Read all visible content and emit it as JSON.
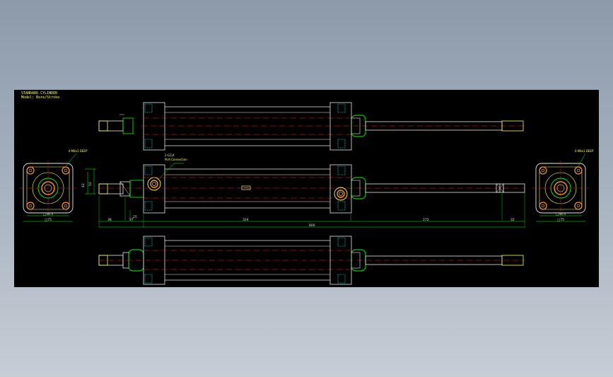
{
  "title_block": {
    "line1": "STANDARD CYLINDER",
    "line2": "Model: Bore/Stroke"
  },
  "notes": {
    "port_label": "2-G1/4",
    "port_sub": "Port Connection",
    "mount_left": "4-M8x1 DEEP",
    "mount_right": "4-M8x1 DEEP"
  },
  "dimensions": {
    "d1": "38",
    "d2": "37",
    "d3": "25",
    "d4": "324",
    "d5": "272",
    "d6": "32",
    "overall": "800",
    "left_flange_1": "□56.5",
    "left_flange_2": "□75",
    "right_flange_1": "□56.5",
    "right_flange_2": "□75",
    "height_1": "42",
    "height_2": "52"
  },
  "colors": {
    "sheet": "#000000",
    "body": "#e8e8e8",
    "centerline": "#ff2020",
    "dimension": "#00ff00",
    "yellow": "#ffff40",
    "orange": "#ff8c1a",
    "hidden": "#00ffff"
  }
}
